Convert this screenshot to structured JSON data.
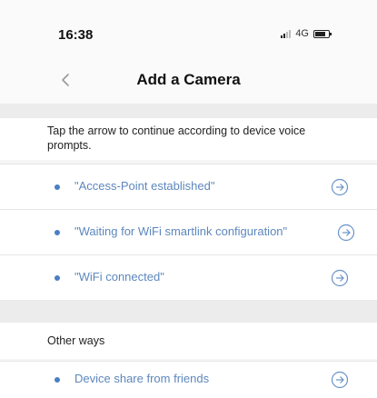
{
  "status_bar": {
    "time": "16:38",
    "network": "4G"
  },
  "nav": {
    "title": "Add a Camera"
  },
  "instruction": "Tap the arrow to continue according to device voice prompts.",
  "prompts": [
    {
      "label": "\"Access-Point established\""
    },
    {
      "label": "\"Waiting for WiFi smartlink configuration\""
    },
    {
      "label": "\"WiFi connected\""
    }
  ],
  "other_ways": {
    "header": "Other ways",
    "items": [
      {
        "label": "Device share from friends"
      }
    ]
  },
  "colors": {
    "accent": "#5d87bd",
    "bullet": "#4a7fc4",
    "background": "#f6f6f6"
  }
}
